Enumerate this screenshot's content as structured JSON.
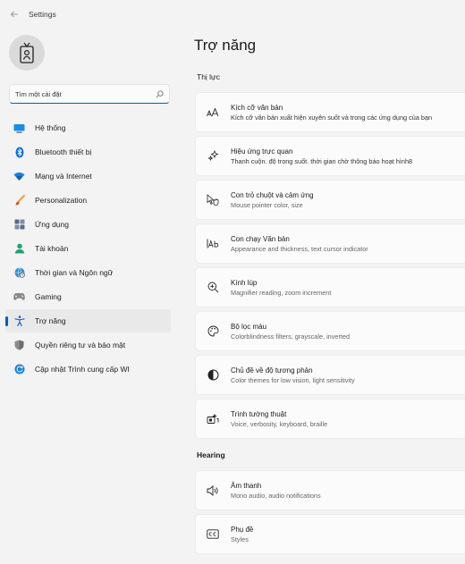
{
  "window": {
    "title": "Settings"
  },
  "search": {
    "placeholder": "Tìm một cài đặt"
  },
  "sidebar": {
    "items": [
      {
        "label": "Hệ thống",
        "icon": "monitor-icon"
      },
      {
        "label": "Bluetooth thiết bị",
        "icon": "bluetooth-icon"
      },
      {
        "label": "Mạng và Internet",
        "icon": "wifi-icon"
      },
      {
        "label": "Personalization",
        "icon": "brush-icon"
      },
      {
        "label": "Ứng dụng",
        "icon": "apps-icon"
      },
      {
        "label": "Tài khoản",
        "icon": "account-icon"
      },
      {
        "label": "Thời gian và Ngôn ngữ",
        "icon": "globe-clock-icon"
      },
      {
        "label": "Gaming",
        "icon": "gamepad-icon"
      },
      {
        "label": "Trợ năng",
        "icon": "accessibility-icon",
        "active": true
      },
      {
        "label": "Quyền riêng tư và bảo mật",
        "icon": "shield-icon"
      },
      {
        "label": "Cập nhật Trình cung cấp WI",
        "icon": "update-icon"
      }
    ]
  },
  "main": {
    "title": "Trợ năng",
    "vision_heading": "Thị lực",
    "hearing_heading": "Hearing",
    "vision_items": [
      {
        "title": "Kích cỡ văn bản",
        "subtitle": "Kích cỡ văn bản xuất hiện xuyên suốt và trong các ứng dụng của bạn",
        "icon": "text-size-icon"
      },
      {
        "title": "Hiệu ứng trực quan",
        "subtitle": "Thanh cuộn. độ trong suốt. thời gian chờ thông báo hoạt hình8",
        "icon": "sparkle-icon"
      },
      {
        "title": "Con trỏ chuột và cảm ứng",
        "subtitle": "Mouse pointer color, size",
        "icon": "mouse-pointer-icon"
      },
      {
        "title": "Con chạy Văn bản",
        "subtitle": "Appearance and thickness, text cursor indicator",
        "icon": "text-cursor-icon"
      },
      {
        "title": "Kính lúp",
        "subtitle": "Magnifier reading, zoom increment",
        "icon": "magnifier-icon"
      },
      {
        "title": "Bộ lọc màu",
        "subtitle": "Colorblindness filters, grayscale, inverted",
        "icon": "palette-icon"
      },
      {
        "title": "Chủ đề về độ tương phản",
        "subtitle": "Color themes for low vision, light sensitivity",
        "icon": "contrast-icon"
      },
      {
        "title": "Trình tường thuật",
        "subtitle": "Voice, verbosity, keyboard, braille",
        "icon": "narrator-icon"
      }
    ],
    "hearing_items": [
      {
        "title": "Âm thanh",
        "subtitle": "Mono audio, audio notifications",
        "icon": "speaker-icon"
      },
      {
        "title": "Phụ đề",
        "subtitle": "Styles",
        "icon": "captions-icon"
      }
    ]
  }
}
